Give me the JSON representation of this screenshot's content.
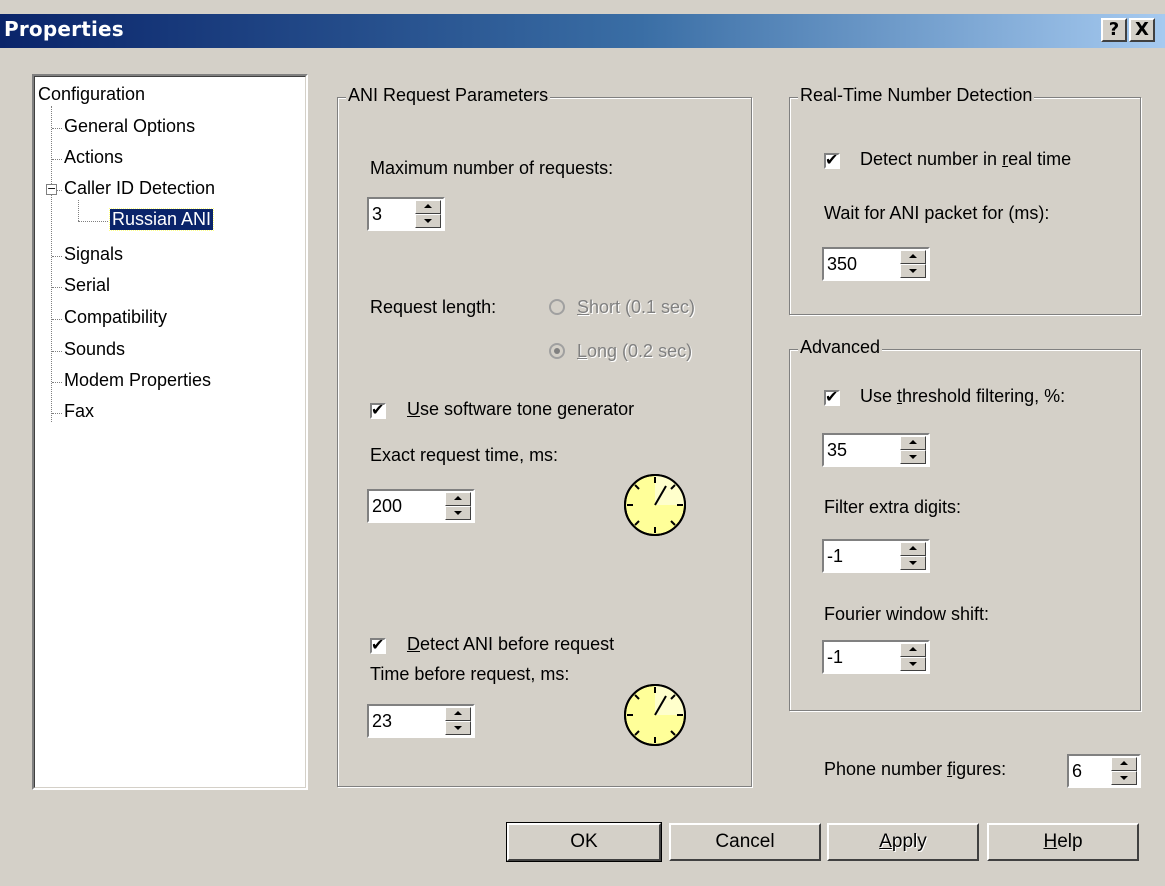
{
  "window": {
    "title": "Properties",
    "help_btn": "?",
    "close_btn": "X"
  },
  "tree": {
    "root": "Configuration",
    "items": [
      {
        "label": "General Options"
      },
      {
        "label": "Actions"
      },
      {
        "label": "Caller ID Detection"
      },
      {
        "label": "Russian ANI"
      },
      {
        "label": "Signals"
      },
      {
        "label": "Serial"
      },
      {
        "label": "Compatibility"
      },
      {
        "label": "Sounds"
      },
      {
        "label": "Modem Properties"
      },
      {
        "label": "Fax"
      }
    ],
    "selected": "Russian ANI"
  },
  "ani": {
    "title": "ANI Request Parameters",
    "max_requests_label": "Maximum number of requests:",
    "max_requests_value": "3",
    "request_length_label": "Request length:",
    "short_pre": "",
    "short_u": "S",
    "short_post": "hort (0.1 sec)",
    "long_pre": "",
    "long_u": "L",
    "long_post": "ong (0.2 sec)",
    "tone_gen_u": "U",
    "tone_gen_post": "se software tone generator",
    "exact_time_label": "Exact request time, ms:",
    "exact_time_value": "200",
    "detect_before_u": "D",
    "detect_before_post": "etect ANI before request",
    "time_before_label": "Time before request, ms:",
    "time_before_value": "23"
  },
  "realtime": {
    "title": "Real-Time Number Detection",
    "detect_pre": "Detect number in ",
    "detect_u": "r",
    "detect_post": "eal time",
    "wait_label": "Wait for ANI packet for (ms):",
    "wait_value": "350"
  },
  "advanced": {
    "title": "Advanced",
    "threshold_pre": "Use ",
    "threshold_u": "t",
    "threshold_post": "hreshold filtering, %:",
    "threshold_value": "35",
    "filter_label": "Filter extra digits:",
    "filter_value": "-1",
    "fourier_label": "Fourier window shift:",
    "fourier_value": "-1"
  },
  "phone": {
    "label_pre": "Phone number ",
    "label_u": "f",
    "label_post": "igures:",
    "value": "6"
  },
  "buttons": {
    "ok": "OK",
    "cancel": "Cancel",
    "apply_u": "A",
    "apply_post": "pply",
    "help_u": "H",
    "help_post": "elp"
  },
  "colors": {
    "face": "#d4d0c8",
    "title_start": "#0a246a",
    "title_end": "#a6caf0",
    "clock_face": "#ffff99"
  }
}
